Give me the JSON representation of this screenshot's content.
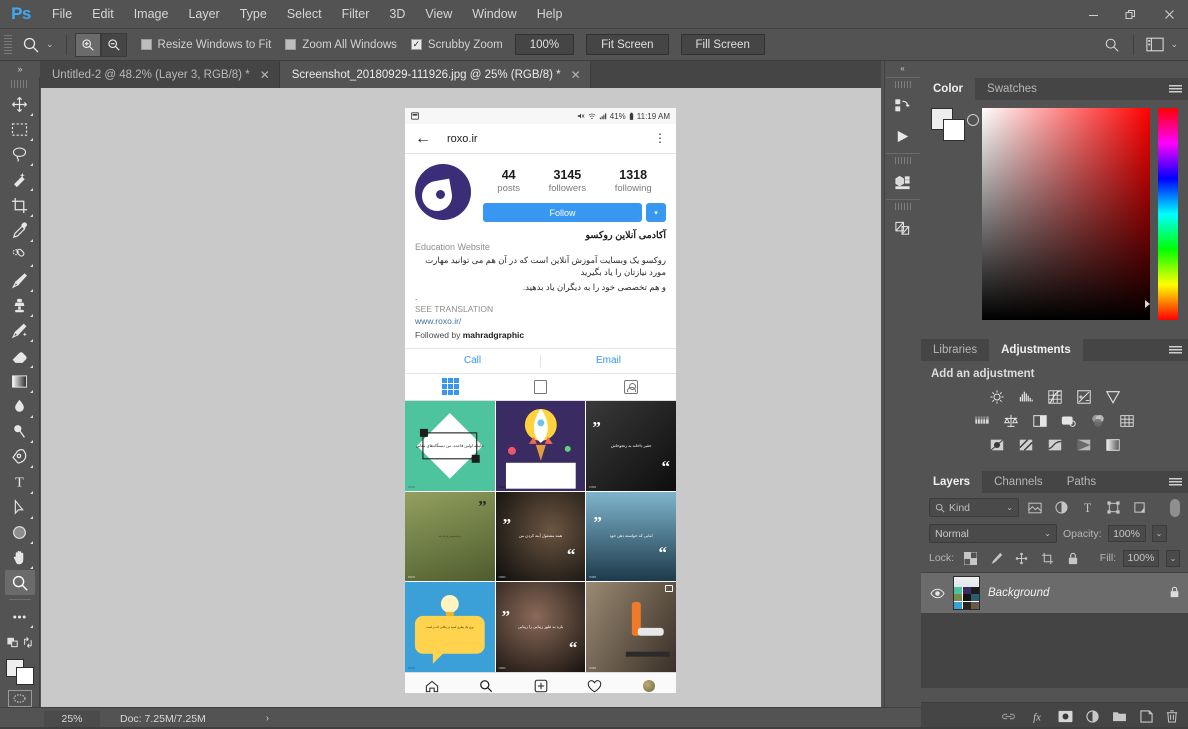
{
  "window": {
    "app_name": "Ps",
    "controls": {
      "minimize": "—",
      "restore": "❐",
      "close": "✕"
    }
  },
  "menubar": {
    "items": [
      "File",
      "Edit",
      "Image",
      "Layer",
      "Type",
      "Select",
      "Filter",
      "3D",
      "View",
      "Window",
      "Help"
    ]
  },
  "options_bar": {
    "tool_icon": "zoom-tool-icon",
    "zoom_in_label": "zoom-in-icon",
    "zoom_out_label": "zoom-out-icon",
    "checkboxes": [
      {
        "label": "Resize Windows to Fit",
        "checked": false
      },
      {
        "label": "Zoom All Windows",
        "checked": false
      },
      {
        "label": "Scrubby Zoom",
        "checked": true
      }
    ],
    "buttons": [
      "100%",
      "Fit Screen",
      "Fill Screen"
    ],
    "search_icon": "search-icon",
    "workspace_icon": "workspace-icon",
    "workspace_caret": "⌄"
  },
  "tabs": {
    "collapse_glyph": "»",
    "items": [
      {
        "label": "Untitled-2 @ 48.2% (Layer 3, RGB/8) *",
        "active": false,
        "close": "✕"
      },
      {
        "label": "Screenshot_20180929-111926.jpg @ 25% (RGB/8) *",
        "active": true,
        "close": "✕"
      }
    ]
  },
  "toolbar": {
    "tools": [
      {
        "name": "move-tool",
        "glyph": "✥",
        "selected": false
      },
      {
        "name": "rectangular-marquee-tool",
        "glyph": "⬚",
        "selected": false
      },
      {
        "name": "lasso-tool",
        "glyph": "○",
        "selected": false
      },
      {
        "name": "quick-selection-tool",
        "glyph": "✦",
        "selected": false
      },
      {
        "name": "crop-tool",
        "glyph": "⌗",
        "selected": false
      },
      {
        "name": "eyedropper-tool",
        "glyph": "✒",
        "selected": false
      },
      {
        "name": "spot-healing-brush-tool",
        "glyph": "⌘",
        "selected": false
      },
      {
        "name": "brush-tool",
        "glyph": "✎",
        "selected": false
      },
      {
        "name": "clone-stamp-tool",
        "glyph": "⚑",
        "selected": false
      },
      {
        "name": "history-brush-tool",
        "glyph": "✐",
        "selected": false
      },
      {
        "name": "eraser-tool",
        "glyph": "▱",
        "selected": false
      },
      {
        "name": "gradient-tool",
        "glyph": "▤",
        "selected": false
      },
      {
        "name": "blur-tool",
        "glyph": "●",
        "selected": false
      },
      {
        "name": "dodge-tool",
        "glyph": "⚲",
        "selected": false
      },
      {
        "name": "pen-tool",
        "glyph": "✑",
        "selected": false
      },
      {
        "name": "type-tool",
        "glyph": "T",
        "selected": false
      },
      {
        "name": "path-selection-tool",
        "glyph": "➤",
        "selected": false
      },
      {
        "name": "ellipse-tool",
        "glyph": "◯",
        "selected": false
      },
      {
        "name": "hand-tool",
        "glyph": "✋",
        "selected": false
      },
      {
        "name": "zoom-tool",
        "glyph": "⌕",
        "selected": true
      },
      {
        "name": "edit-toolbar",
        "glyph": "…",
        "selected": false
      }
    ],
    "foreground_color": "#ededed",
    "background_color": "#ffffff",
    "quick_mask_icon": "quick-mask-icon"
  },
  "canvas": {
    "phone": {
      "status_bar": {
        "left_icon": "screenshot-icon",
        "mute_icon": "mute-icon",
        "wifi_icon": "wifi-icon",
        "signal_icon": "signal-icon",
        "battery_percent": "41%",
        "battery_icon": "battery-icon",
        "time": "11:19 AM"
      },
      "appbar": {
        "back_glyph": "←",
        "title": "roxo.ir",
        "menu_glyph": "⋮"
      },
      "profile": {
        "avatar_name": "profile-avatar",
        "stats": [
          {
            "value": "44",
            "label": "posts"
          },
          {
            "value": "3145",
            "label": "followers"
          },
          {
            "value": "1318",
            "label": "following"
          }
        ],
        "follow_label": "Follow",
        "follow_caret": "▾"
      },
      "bio": {
        "name": "آکادمی آنلاین روکسو",
        "category": "Education Website",
        "text_line1": "روکسو یک وبسایت آموزش آنلاین است که در آن هم می توانید مهارت مورد نیازتان را یاد بگیرید",
        "text_line2": "و هم تخصصی خود را به دیگران یاد بدهید.",
        "dot": ".",
        "see_translation": "SEE TRANSLATION",
        "website": "www.roxo.ir/",
        "followed_by_prefix": "Followed by ",
        "followed_by_user": "mahradgraphic"
      },
      "actions": {
        "call": "Call",
        "email": "Email"
      },
      "content_tabs": [
        {
          "name": "grid-tab",
          "active": true
        },
        {
          "name": "list-tab",
          "active": false
        },
        {
          "name": "tagged-tab",
          "active": false
        }
      ],
      "grid_posts": [
        {
          "name": "post-diamond-quote",
          "bg": "#4ec49e",
          "text": "جامعه اولین قاعده، من دستگاه‌های معانی",
          "brand": "roxo",
          "caption": ""
        },
        {
          "name": "post-rocket",
          "bg": "#3a2b62",
          "text": "",
          "brand": "roxo",
          "caption": ""
        },
        {
          "name": "post-portrait-quote-1",
          "bg": "#1d1d1d",
          "text": "حقیر داخانه به رنجوحاش",
          "brand": "roxo",
          "caption": ""
        },
        {
          "name": "post-green-frontend",
          "bg": "#7a8a4c",
          "text": "برنامه‌نویس فرانت‌اند",
          "brand": "roxo",
          "caption": ""
        },
        {
          "name": "post-trophy-quote",
          "bg": "#141414",
          "text": "همه مشغول آینه کردن من",
          "brand": "roxo",
          "caption": ""
        },
        {
          "name": "post-mountain-quote",
          "bg": "#2e5a72",
          "text": "امایی که خواسته ذهن خود",
          "brand": "roxo",
          "caption": ""
        },
        {
          "name": "post-lightbulb",
          "bg": "#3ca0d8",
          "text": "وزن یک بطری اسید در مکانی که در است",
          "brand": "roxo",
          "caption": ""
        },
        {
          "name": "post-woman-quote",
          "bg": "#2a2420",
          "text": "بازه به طور زیبایی را زیبایی",
          "brand": "roxo",
          "caption": ""
        },
        {
          "name": "post-robot-chess",
          "bg": "#6a5a48",
          "text": "",
          "brand": "roxo",
          "caption": "",
          "multi": true
        }
      ],
      "bottom_nav": [
        {
          "name": "home-icon"
        },
        {
          "name": "search-icon"
        },
        {
          "name": "add-post-icon"
        },
        {
          "name": "activity-heart-icon"
        },
        {
          "name": "profile-avatar-icon"
        }
      ]
    }
  },
  "dock_strip": {
    "collapse_glyph": "«",
    "icons": [
      {
        "name": "history-actions-icon"
      },
      {
        "name": "play-icon"
      },
      {
        "name": "3d-icon"
      },
      {
        "name": "layer-comps-icon"
      }
    ]
  },
  "color_panel": {
    "tabs": [
      {
        "label": "Color",
        "active": true
      },
      {
        "label": "Swatches",
        "active": false
      }
    ],
    "menu_icon": "panel-menu-icon",
    "foreground_color": "#ededed",
    "background_color": "#ffffff",
    "spectrum_hue": "#ff0000"
  },
  "adjustments_panel": {
    "tabs": [
      {
        "label": "Libraries",
        "active": false
      },
      {
        "label": "Adjustments",
        "active": true
      }
    ],
    "menu_icon": "panel-menu-icon",
    "title": "Add an adjustment",
    "row1": [
      "brightness-contrast-icon",
      "levels-icon",
      "curves-icon",
      "exposure-icon",
      "vibrance-icon"
    ],
    "row2": [
      "hue-saturation-icon",
      "color-balance-icon",
      "black-white-icon",
      "photo-filter-icon",
      "channel-mixer-icon",
      "color-lookup-icon"
    ],
    "row3": [
      "invert-icon",
      "posterize-icon",
      "threshold-icon",
      "gradient-map-icon",
      "selective-color-icon"
    ]
  },
  "layers_panel": {
    "tabs": [
      {
        "label": "Layers",
        "active": true
      },
      {
        "label": "Channels",
        "active": false
      },
      {
        "label": "Paths",
        "active": false
      }
    ],
    "menu_icon": "panel-menu-icon",
    "filter": {
      "kind_label": "Kind",
      "search_icon": "search-icon",
      "caret": "⌄",
      "filter_icons": [
        "pixel-filter-icon",
        "adjustment-filter-icon",
        "type-filter-icon",
        "shape-filter-icon",
        "smart-object-filter-icon"
      ],
      "toggle_name": "filter-toggle"
    },
    "blend_mode": "Normal",
    "blend_caret": "⌄",
    "opacity_label": "Opacity:",
    "opacity_value": "100%",
    "lock_label": "Lock:",
    "lock_icons": [
      "lock-transparent-icon",
      "lock-image-icon",
      "lock-position-icon",
      "lock-artboard-icon",
      "lock-all-icon"
    ],
    "fill_label": "Fill:",
    "fill_value": "100%",
    "layers": [
      {
        "name": "Background",
        "visible": true,
        "locked": true,
        "italic": true
      }
    ],
    "footer_icons": [
      "link-layers-icon",
      "layer-style-fx-icon",
      "layer-mask-icon",
      "new-adjustment-layer-icon",
      "new-group-icon",
      "new-layer-icon",
      "delete-layer-icon"
    ]
  },
  "status_bar": {
    "zoom": "25%",
    "doc_info": "Doc: 7.25M/7.25M",
    "caret": "›"
  }
}
